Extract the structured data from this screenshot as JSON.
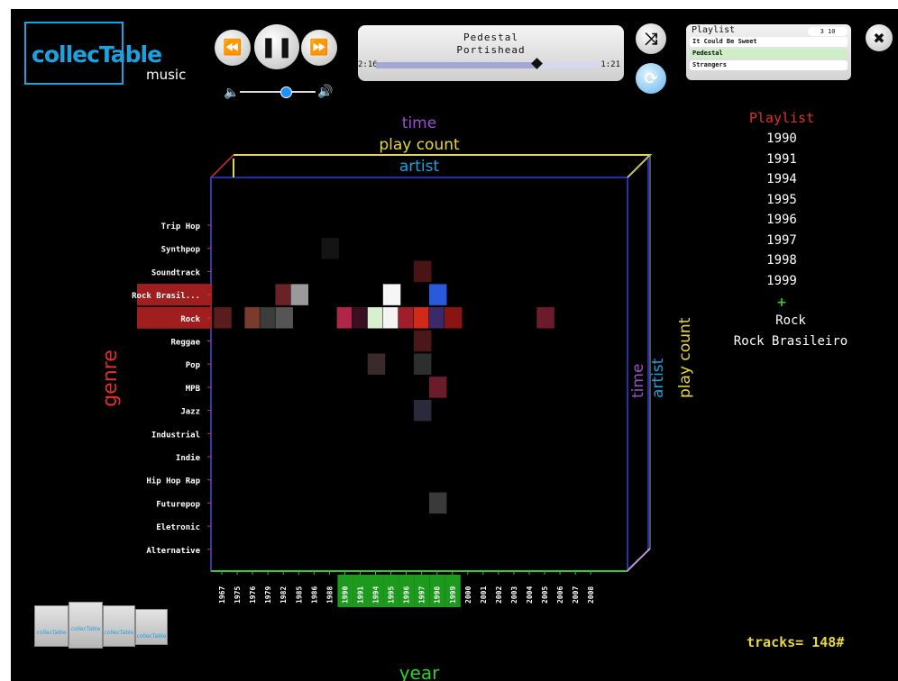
{
  "brand": {
    "name": "collecTable",
    "sub": "music"
  },
  "transport": {
    "prev_glyph": "⏪",
    "pause_glyph": "❚❚",
    "next_glyph": "⏩",
    "shuffle_glyph": "⤨",
    "repeat_glyph": "⟳",
    "close_glyph": "✖",
    "volume_level": 0.6
  },
  "now_playing": {
    "title": "Pedestal",
    "artist": "Portishead",
    "elapsed": "2:16",
    "remaining": "1:21",
    "progress": 0.72
  },
  "mini_playlist": {
    "title": "Playlist",
    "count": "3 10",
    "items": [
      {
        "label": "It Could Be Sweet",
        "active": false
      },
      {
        "label": "Pedestal",
        "active": true
      },
      {
        "label": "Strangers",
        "active": false
      }
    ]
  },
  "sidebar": {
    "title": "Playlist",
    "years": [
      "1990",
      "1991",
      "1994",
      "1995",
      "1996",
      "1997",
      "1998",
      "1999"
    ],
    "plus": "+",
    "genres": [
      "Rock",
      "Rock Brasileiro"
    ]
  },
  "tracks_label": "tracks= 148#",
  "chart_data": {
    "type": "heatmap",
    "axes": {
      "top": [
        "time",
        "play count",
        "artist"
      ],
      "right": [
        "time",
        "artist",
        "play count"
      ],
      "left": "genre",
      "bottom": "year"
    },
    "genres": [
      "Trip Hop",
      "Synthpop",
      "Soundtrack",
      "Rock Brasil...",
      "Rock",
      "Reggae",
      "Pop",
      "MPB",
      "Jazz",
      "Industrial",
      "Indie",
      "Hip Hop Rap",
      "Futurepop",
      "Eletronic",
      "Alternative"
    ],
    "highlighted_genres": [
      "Rock Brasil...",
      "Rock"
    ],
    "years": [
      "1967",
      "1975",
      "1976",
      "1979",
      "1982",
      "1985",
      "1986",
      "1988",
      "1990",
      "1991",
      "1994",
      "1995",
      "1996",
      "1997",
      "1998",
      "1999",
      "2000",
      "2001",
      "2002",
      "2003",
      "2004",
      "2005",
      "2006",
      "2007",
      "2008"
    ],
    "highlighted_years": [
      "1990",
      "1991",
      "1994",
      "1995",
      "1996",
      "1997",
      "1998",
      "1999"
    ],
    "covers": [
      {
        "genre": "Rock",
        "year": "1967",
        "color": "#5a1c1c"
      },
      {
        "genre": "Rock",
        "year": "1976",
        "color": "#7a3a2c"
      },
      {
        "genre": "Rock",
        "year": "1979",
        "color": "#3c3c3c"
      },
      {
        "genre": "Rock",
        "year": "1982",
        "color": "#555555"
      },
      {
        "genre": "Rock",
        "year": "1990",
        "color": "#b0264a"
      },
      {
        "genre": "Rock",
        "year": "1991",
        "color": "#3a1020"
      },
      {
        "genre": "Rock",
        "year": "1994",
        "color": "#d8efd0"
      },
      {
        "genre": "Rock",
        "year": "1995",
        "color": "#f4f4f4"
      },
      {
        "genre": "Rock",
        "year": "1996",
        "color": "#a01e2a"
      },
      {
        "genre": "Rock",
        "year": "1997",
        "color": "#d22a1a"
      },
      {
        "genre": "Rock",
        "year": "1998",
        "color": "#3a2a6a"
      },
      {
        "genre": "Rock",
        "year": "1999",
        "color": "#8a1414"
      },
      {
        "genre": "Rock",
        "year": "2005",
        "color": "#6a1c2a"
      },
      {
        "genre": "Rock Brasil...",
        "year": "1982",
        "color": "#6a2226"
      },
      {
        "genre": "Rock Brasil...",
        "year": "1985",
        "color": "#9a9a9a"
      },
      {
        "genre": "Rock Brasil...",
        "year": "1995",
        "color": "#f6f6f6"
      },
      {
        "genre": "Rock Brasil...",
        "year": "1998",
        "color": "#2a5adc"
      },
      {
        "genre": "Soundtrack",
        "year": "1997",
        "color": "#4a1414"
      },
      {
        "genre": "Reggae",
        "year": "1997",
        "color": "#4a1818"
      },
      {
        "genre": "Pop",
        "year": "1994",
        "color": "#3a2a2a"
      },
      {
        "genre": "Pop",
        "year": "1997",
        "color": "#2e2e2e"
      },
      {
        "genre": "MPB",
        "year": "1998",
        "color": "#6a1c2a"
      },
      {
        "genre": "Jazz",
        "year": "1997",
        "color": "#2a2a3a"
      },
      {
        "genre": "Synthpop",
        "year": "1988",
        "color": "#141414"
      },
      {
        "genre": "Futurepop",
        "year": "1998",
        "color": "#3a3a3a"
      }
    ]
  },
  "thumbnail_strip": {
    "label": "collecTable"
  }
}
